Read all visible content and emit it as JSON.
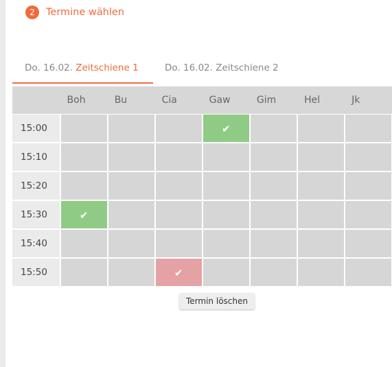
{
  "step": {
    "number": "2",
    "title": "Termine wählen"
  },
  "tabs": [
    {
      "date": "Do. 16.02.",
      "label": "Zeitschiene 1",
      "active": true
    },
    {
      "date": "Do. 16.02.",
      "label": "Zeitschiene 2",
      "active": false
    }
  ],
  "columns": [
    "Boh",
    "Bu",
    "Cia",
    "Gaw",
    "Gim",
    "Hel",
    "Jk"
  ],
  "rows": [
    {
      "time": "15:00",
      "cells": [
        "",
        "",
        "",
        "booked",
        "",
        "",
        ""
      ]
    },
    {
      "time": "15:10",
      "cells": [
        "",
        "",
        "",
        "",
        "",
        "",
        ""
      ]
    },
    {
      "time": "15:20",
      "cells": [
        "",
        "",
        "",
        "",
        "",
        "",
        ""
      ]
    },
    {
      "time": "15:30",
      "cells": [
        "booked",
        "",
        "",
        "",
        "",
        "",
        ""
      ]
    },
    {
      "time": "15:40",
      "cells": [
        "",
        "",
        "",
        "",
        "",
        "",
        ""
      ]
    },
    {
      "time": "15:50",
      "cells": [
        "",
        "",
        "delete",
        "",
        "",
        "",
        ""
      ]
    }
  ],
  "tooltip": "Termin löschen",
  "icons": {
    "check": "check-icon"
  },
  "colors": {
    "accent": "#f06a3b",
    "booked": "#8fcb85",
    "delete_hover": "#e5a2a5",
    "empty": "#d6d6d6"
  }
}
